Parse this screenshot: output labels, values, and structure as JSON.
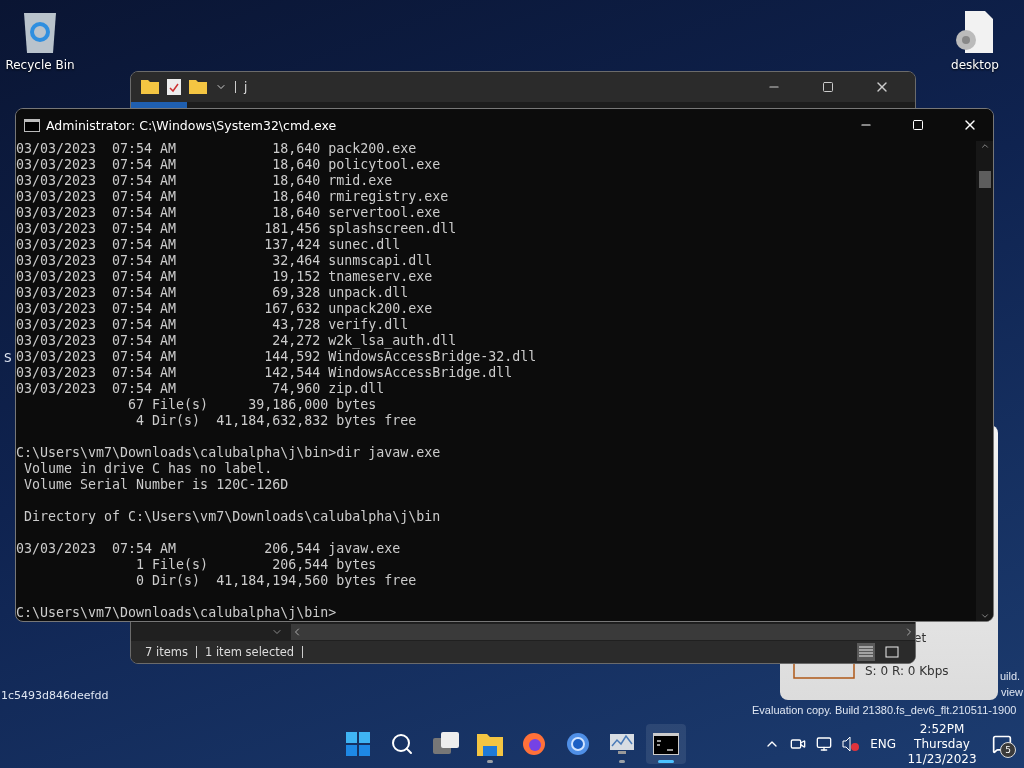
{
  "desktop": {
    "icons": [
      {
        "kind": "recycle",
        "label": "Recycle Bin"
      },
      {
        "kind": "settings-file",
        "label": "desktop"
      }
    ],
    "partial_label": "S",
    "id_text": "1c5493d846deefdd",
    "watermark": [
      "uild.",
      "view",
      "Evaluation copy. Build 21380.fs_dev6_flt.210511-1900"
    ]
  },
  "explorer": {
    "title": "j",
    "status": [
      "7 items",
      "1 item selected"
    ]
  },
  "widget": {
    "title": "et",
    "reading": "S: 0 R: 0 Kbps"
  },
  "console": {
    "title": "Administrator: C:\\Windows\\System32\\cmd.exe",
    "blocks": [
      [
        "03/03/2023  07:54 AM            18,640 pack200.exe",
        "03/03/2023  07:54 AM            18,640 policytool.exe",
        "03/03/2023  07:54 AM            18,640 rmid.exe",
        "03/03/2023  07:54 AM            18,640 rmiregistry.exe",
        "03/03/2023  07:54 AM            18,640 servertool.exe",
        "03/03/2023  07:54 AM           181,456 splashscreen.dll",
        "03/03/2023  07:54 AM           137,424 sunec.dll",
        "03/03/2023  07:54 AM            32,464 sunmscapi.dll",
        "03/03/2023  07:54 AM            19,152 tnameserv.exe",
        "03/03/2023  07:54 AM            69,328 unpack.dll",
        "03/03/2023  07:54 AM           167,632 unpack200.exe",
        "03/03/2023  07:54 AM            43,728 verify.dll",
        "03/03/2023  07:54 AM            24,272 w2k_lsa_auth.dll",
        "03/03/2023  07:54 AM           144,592 WindowsAccessBridge-32.dll",
        "03/03/2023  07:54 AM           142,544 WindowsAccessBridge.dll",
        "03/03/2023  07:54 AM            74,960 zip.dll",
        "              67 File(s)     39,186,000 bytes",
        "               4 Dir(s)  41,184,632,832 bytes free"
      ],
      [
        "C:\\Users\\vm7\\Downloads\\calubalpha\\j\\bin>dir javaw.exe",
        " Volume in drive C has no label.",
        " Volume Serial Number is 120C-126D"
      ],
      [
        " Directory of C:\\Users\\vm7\\Downloads\\calubalpha\\j\\bin"
      ],
      [
        "03/03/2023  07:54 AM           206,544 javaw.exe",
        "               1 File(s)        206,544 bytes",
        "               0 Dir(s)  41,184,194,560 bytes free"
      ],
      [
        "C:\\Users\\vm7\\Downloads\\calubalpha\\j\\bin>"
      ]
    ]
  },
  "taskbar": {
    "apps": [
      {
        "kind": "start",
        "running": false,
        "selected": false
      },
      {
        "kind": "search",
        "running": false,
        "selected": false
      },
      {
        "kind": "taskview",
        "running": false,
        "selected": false
      },
      {
        "kind": "explorer",
        "running": true,
        "selected": false
      },
      {
        "kind": "firefox",
        "running": false,
        "selected": false
      },
      {
        "kind": "browser",
        "running": false,
        "selected": false
      },
      {
        "kind": "monitor",
        "running": true,
        "selected": false
      },
      {
        "kind": "terminal",
        "running": true,
        "selected": true
      }
    ],
    "tray": {
      "language": "ENG",
      "time": "2:52PM",
      "day": "Thursday",
      "date": "11/23/2023",
      "notifications": "5"
    }
  }
}
